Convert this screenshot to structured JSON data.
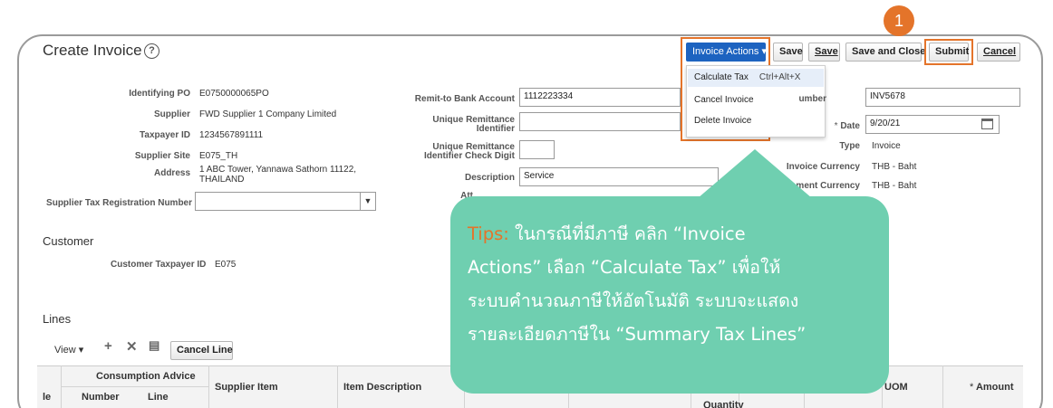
{
  "header": {
    "title": "Create Invoice",
    "help_glyph": "?",
    "step_badge": "1"
  },
  "toolbar": {
    "invoice_actions": "Invoice Actions",
    "save": "Save",
    "save2": "Save",
    "save_and_close": "Save and Close",
    "submit": "Submit",
    "cancel": "Cancel"
  },
  "menu": {
    "items": [
      {
        "label": "Calculate Tax",
        "shortcut": "Ctrl+Alt+X"
      },
      {
        "label": "Cancel Invoice"
      },
      {
        "label": "Delete Invoice"
      }
    ]
  },
  "left_form": {
    "identifying_po_label": "Identifying PO",
    "identifying_po": "E0750000065PO",
    "supplier_label": "Supplier",
    "supplier": "FWD Supplier 1 Company Limited",
    "taxpayer_id_label": "Taxpayer ID",
    "taxpayer_id": "1234567891111",
    "supplier_site_label": "Supplier Site",
    "supplier_site": "E075_TH",
    "address_label": "Address",
    "address_line1": "1 ABC Tower, Yannawa Sathorn 11122,",
    "address_line2": "THAILAND",
    "supplier_tax_reg_label": "Supplier Tax Registration Number",
    "supplier_tax_reg_value": ""
  },
  "middle_form": {
    "remit_bank_label": "Remit-to Bank Account",
    "remit_bank": "1112223334",
    "unique_remit_label1": "Unique Remittance",
    "unique_remit_label2": "Identifier",
    "unique_remit": "",
    "check_digit_label1": "Unique Remittance",
    "check_digit_label2": "Identifier Check Digit",
    "check_digit": "",
    "description_label": "Description",
    "description": "Service",
    "attachments_label": "Att"
  },
  "right_form": {
    "number_label": "umber",
    "number": "INV5678",
    "date_label": "Date",
    "date_required": "*",
    "date": "9/20/21",
    "type_label": "Type",
    "type": "Invoice",
    "invoice_currency_label": "Invoice Currency",
    "invoice_currency": "THB - Baht",
    "payment_currency_label": "ment Currency",
    "payment_currency": "THB - Baht"
  },
  "customer": {
    "section": "Customer",
    "taxpayer_label": "Customer Taxpayer ID",
    "taxpayer": "E075"
  },
  "lines": {
    "section": "Lines",
    "view": "View",
    "cancel_line": "Cancel Line",
    "headers": {
      "le": "le",
      "consumption_advice": "Consumption Advice",
      "number": "Number",
      "line": "Line",
      "supplier_item": "Supplier Item",
      "item_description": "Item Description",
      "quantity": "Quantity",
      "uom_partial": "e",
      "uom": "UOM",
      "amount_required": "*",
      "amount": "Amount"
    }
  },
  "tip": {
    "label": "Tips:",
    "line1": " ในกรณีที่มีภาษี คลิก “Invoice",
    "line2": "Actions” เลือก “Calculate Tax” เพื่อให้",
    "line3": "ระบบคำนวณภาษีให้อัตโนมัติ ระบบจะแสดง",
    "line4": "รายละเอียดภาษีใน “Summary Tax Lines”"
  },
  "colors": {
    "accent": "#e4742a",
    "tip_bg": "#6fcfb0",
    "button_blue": "#1d63c0"
  }
}
